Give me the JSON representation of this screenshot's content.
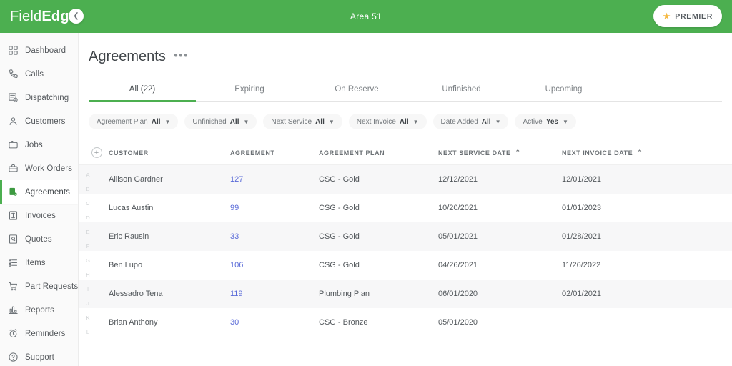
{
  "topbar": {
    "brand_light": "Field",
    "brand_bold": "Edge",
    "area": "Area 51",
    "premier_label": "PREMIER",
    "star_icon": "star-icon",
    "brand_color": "#4caf50"
  },
  "sidebar": {
    "collapse_icon": "chevron-left-icon",
    "items": [
      {
        "label": "Dashboard",
        "icon": "dashboard-icon",
        "active": false
      },
      {
        "label": "Calls",
        "icon": "phone-icon",
        "active": false
      },
      {
        "label": "Dispatching",
        "icon": "dispatch-icon",
        "active": false
      },
      {
        "label": "Customers",
        "icon": "person-icon",
        "active": false
      },
      {
        "label": "Jobs",
        "icon": "briefcase-icon",
        "active": false
      },
      {
        "label": "Work Orders",
        "icon": "toolbox-icon",
        "active": false
      },
      {
        "label": "Agreements",
        "icon": "agreement-icon",
        "active": true
      },
      {
        "label": "Invoices",
        "icon": "invoice-icon",
        "active": false
      },
      {
        "label": "Quotes",
        "icon": "quote-icon",
        "active": false
      },
      {
        "label": "Items",
        "icon": "list-icon",
        "active": false
      },
      {
        "label": "Part Requests",
        "icon": "cart-icon",
        "active": false
      },
      {
        "label": "Reports",
        "icon": "bar-chart-icon",
        "active": false
      },
      {
        "label": "Reminders",
        "icon": "alarm-clock-icon",
        "active": false
      },
      {
        "label": "Support",
        "icon": "help-circle-icon",
        "active": false
      }
    ]
  },
  "page": {
    "title": "Agreements",
    "kebab": "•••"
  },
  "tabs": [
    {
      "label": "All (22)",
      "selected": true
    },
    {
      "label": "Expiring",
      "selected": false
    },
    {
      "label": "On Reserve",
      "selected": false
    },
    {
      "label": "Unfinished",
      "selected": false
    },
    {
      "label": "Upcoming",
      "selected": false
    }
  ],
  "filters": [
    {
      "label": "Agreement Plan",
      "value": "All",
      "caret": "chevron-down-icon"
    },
    {
      "label": "Unfinished",
      "value": "All",
      "caret": "chevron-down-icon"
    },
    {
      "label": "Next Service",
      "value": "All",
      "caret": "chevron-down-icon"
    },
    {
      "label": "Next Invoice",
      "value": "All",
      "caret": "chevron-down-icon"
    },
    {
      "label": "Date Added",
      "value": "All",
      "caret": "chevron-down-icon"
    },
    {
      "label": "Active",
      "value": "Yes",
      "caret": "chevron-down-icon"
    }
  ],
  "table": {
    "add_icon": "plus-circle-icon",
    "columns": [
      {
        "label": "CUSTOMER",
        "sort": ""
      },
      {
        "label": "AGREEMENT",
        "sort": ""
      },
      {
        "label": "AGREEMENT PLAN",
        "sort": ""
      },
      {
        "label": "NEXT SERVICE DATE",
        "sort": "⌃"
      },
      {
        "label": "NEXT INVOICE DATE",
        "sort": "⌃"
      }
    ],
    "rows": [
      {
        "customer": "Allison Gardner",
        "agreement": "127",
        "plan": "CSG - Gold",
        "next_service": "12/12/2021",
        "next_invoice": "12/01/2021"
      },
      {
        "customer": "Lucas Austin",
        "agreement": "99",
        "plan": "CSG - Gold",
        "next_service": "10/20/2021",
        "next_invoice": "01/01/2023"
      },
      {
        "customer": "Eric Rausin",
        "agreement": "33",
        "plan": "CSG - Gold",
        "next_service": "05/01/2021",
        "next_invoice": "01/28/2021"
      },
      {
        "customer": "Ben Lupo",
        "agreement": "106",
        "plan": "CSG - Gold",
        "next_service": "04/26/2021",
        "next_invoice": "11/26/2022"
      },
      {
        "customer": "Alessadro Tena",
        "agreement": "119",
        "plan": "Plumbing Plan",
        "next_service": "06/01/2020",
        "next_invoice": "02/01/2021"
      },
      {
        "customer": "Brian Anthony",
        "agreement": "30",
        "plan": "CSG - Bronze",
        "next_service": "05/01/2020",
        "next_invoice": ""
      }
    ],
    "alpha_index": [
      "A",
      "B",
      "C",
      "D",
      "E",
      "F",
      "G",
      "H",
      "I",
      "J",
      "K",
      "L"
    ]
  }
}
